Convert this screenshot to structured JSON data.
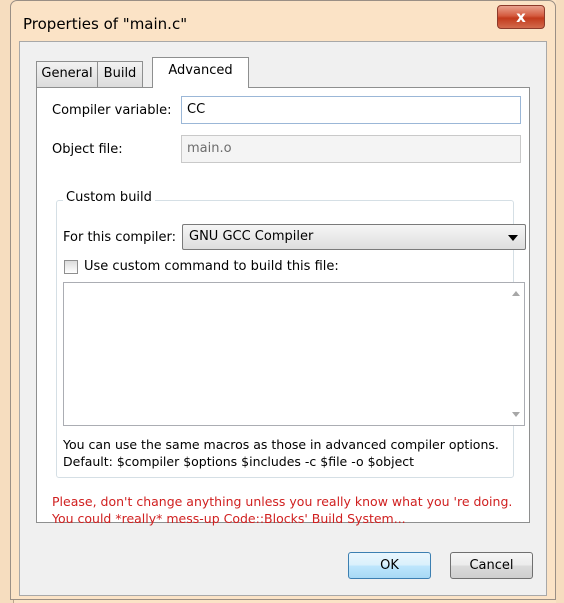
{
  "window": {
    "title": "Properties of \"main.c\"",
    "close_icon": "close-x-icon",
    "close_glyph": "x"
  },
  "tabs": [
    {
      "label": "General",
      "active": false
    },
    {
      "label": "Build",
      "active": false
    },
    {
      "label": "Advanced",
      "active": true
    }
  ],
  "advanced": {
    "compiler_variable_label": "Compiler variable:",
    "compiler_variable_value": "CC",
    "object_file_label": "Object file:",
    "object_file_value": "main.o",
    "custom_build": {
      "title": "Custom build",
      "for_compiler_label": "For this compiler:",
      "compiler_selected": "GNU GCC Compiler",
      "use_custom_label": "Use custom command to build this file:",
      "use_custom_checked": false,
      "command_text": "",
      "hint_line1": "You can use the same macros as those in advanced compiler options.",
      "hint_line2": "Default: $compiler $options $includes -c $file -o $object"
    },
    "warning_line1": "Please, don't change anything unless you really know what you 're doing.",
    "warning_line2": "You could *really* mess-up Code::Blocks' Build System..."
  },
  "buttons": {
    "ok": "OK",
    "cancel": "Cancel"
  },
  "colors": {
    "window_frame": "#fbe3c6",
    "warning_text": "#d02020",
    "close_button": "#c8452a"
  }
}
